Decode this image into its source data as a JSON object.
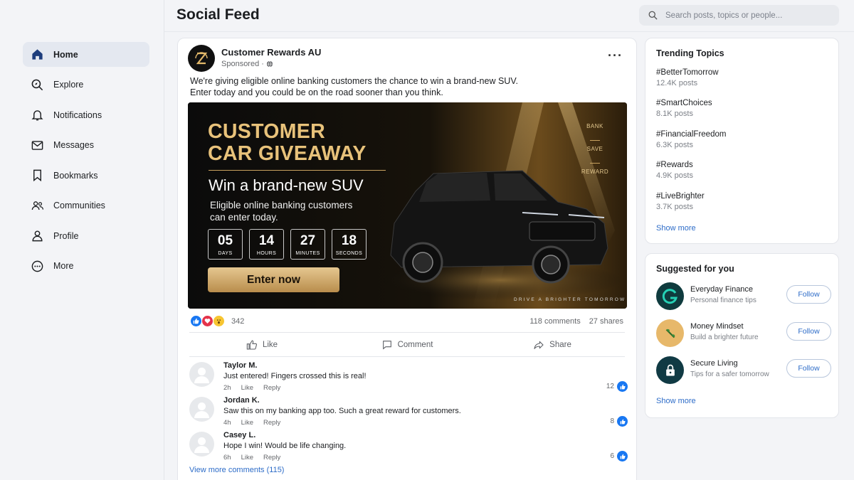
{
  "header": {
    "title": "Social Feed",
    "search_placeholder": "Search posts, topics or people..."
  },
  "sidebar": {
    "items": [
      {
        "label": "Home",
        "icon": "home-icon",
        "active": true
      },
      {
        "label": "Explore",
        "icon": "explore-icon"
      },
      {
        "label": "Notifications",
        "icon": "bell-icon"
      },
      {
        "label": "Messages",
        "icon": "mail-icon"
      },
      {
        "label": "Bookmarks",
        "icon": "bookmark-icon"
      },
      {
        "label": "Communities",
        "icon": "people-icon"
      },
      {
        "label": "Profile",
        "icon": "user-icon"
      },
      {
        "label": "More",
        "icon": "more-icon"
      }
    ]
  },
  "post": {
    "author": "Customer Rewards AU",
    "sponsored": "Sponsored ·",
    "text_line1": "We're giving eligible online banking customers the chance to win a brand-new SUV.",
    "text_line2": "Enter today and you could be on the road sooner than you think.",
    "banner": {
      "title_line1": "CUSTOMER",
      "title_line2": "CAR GIVEAWAY",
      "subtitle": "Win a brand-new SUV",
      "desc_line1": "Eligible online banking customers",
      "desc_line2": "can enter today.",
      "countdown": [
        {
          "value": "05",
          "label": "DAYS"
        },
        {
          "value": "14",
          "label": "HOURS"
        },
        {
          "value": "27",
          "label": "MINUTES"
        },
        {
          "value": "18",
          "label": "SECONDS"
        }
      ],
      "cta": "Enter now",
      "side_words": [
        "BANK",
        "SAVE",
        "REWARD"
      ],
      "tagline": "DRIVE A BRIGHTER TOMORROW",
      "accent_color": "#e8c27a"
    },
    "reaction_count": "342",
    "comments_count": "118 comments",
    "shares_count": "27 shares",
    "actions": {
      "like": "Like",
      "comment": "Comment",
      "share": "Share"
    },
    "comments": [
      {
        "name": "Taylor M.",
        "text": "Just entered! Fingers crossed this is real!",
        "time": "2h",
        "like": "Like",
        "reply": "Reply",
        "likes": "12"
      },
      {
        "name": "Jordan K.",
        "text": "Saw this on my banking app too. Such a great reward for customers.",
        "time": "4h",
        "like": "Like",
        "reply": "Reply",
        "likes": "8"
      },
      {
        "name": "Casey L.",
        "text": "Hope I win! Would be life changing.",
        "time": "6h",
        "like": "Like",
        "reply": "Reply",
        "likes": "6"
      }
    ],
    "view_more": "View more comments (115)"
  },
  "trending": {
    "title": "Trending Topics",
    "items": [
      {
        "tag": "#BetterTomorrow",
        "count": "12.4K posts"
      },
      {
        "tag": "#SmartChoices",
        "count": "8.1K posts"
      },
      {
        "tag": "#FinancialFreedom",
        "count": "6.3K posts"
      },
      {
        "tag": "#Rewards",
        "count": "4.9K posts"
      },
      {
        "tag": "#LiveBrighter",
        "count": "3.7K posts"
      }
    ],
    "show_more": "Show more"
  },
  "suggested": {
    "title": "Suggested for you",
    "items": [
      {
        "name": "Everyday Finance",
        "desc": "Personal finance tips",
        "follow": "Follow",
        "icon": "finance-logo-icon",
        "color": "#0f3b3e"
      },
      {
        "name": "Money Mindset",
        "desc": "Build a brighter future",
        "follow": "Follow",
        "icon": "plant-icon",
        "color": "#e7b86a"
      },
      {
        "name": "Secure Living",
        "desc": "Tips for a safer tomorrow",
        "follow": "Follow",
        "icon": "lock-icon",
        "color": "#103a44"
      }
    ],
    "show_more": "Show more"
  },
  "colors": {
    "link": "#2d6cc8",
    "like_blue": "#1877f2",
    "heart_red": "#e4334b"
  }
}
